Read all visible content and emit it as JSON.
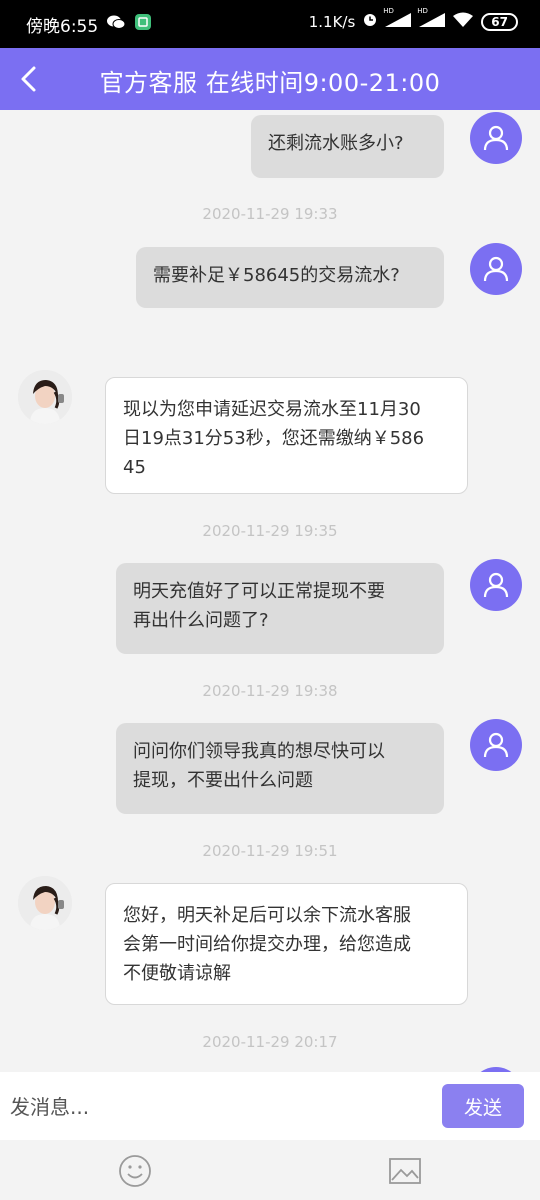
{
  "status_bar": {
    "time": "傍晚6:55",
    "speed": "1.1K/s",
    "battery": "67",
    "hd1": "HD",
    "hd2": "HD"
  },
  "header": {
    "title": "官方客服 在线时间9:00-21:00"
  },
  "messages": [
    {
      "from": "user",
      "text": "还剩流水账多小?"
    },
    {
      "time": "2020-11-29 19:33"
    },
    {
      "from": "user",
      "text": "需要补足￥58645的交易流水?"
    },
    {
      "from": "agent",
      "lines": [
        "现以为您申请延迟交易流水至11月30",
        "日19点31分53秒，您还需缴纳￥586",
        "45"
      ]
    },
    {
      "time": "2020-11-29 19:35"
    },
    {
      "from": "user",
      "lines": [
        "明天充值好了可以正常提现不要",
        "再出什么问题了?"
      ]
    },
    {
      "time": "2020-11-29 19:38"
    },
    {
      "from": "user",
      "lines": [
        "问问你们领导我真的想尽快可以",
        "提现，不要出什么问题"
      ]
    },
    {
      "time": "2020-11-29 19:51"
    },
    {
      "from": "agent",
      "lines": [
        "您好，明天补足后可以余下流水客服",
        "会第一时间给你提交办理，给您造成",
        "不便敬请谅解"
      ]
    },
    {
      "time": "2020-11-29 20:17"
    }
  ],
  "input": {
    "placeholder": "发消息...",
    "send_label": "发送"
  },
  "icons": {
    "back": "chevron-left-icon",
    "emoji": "smiley-icon",
    "image": "image-icon",
    "user_avatar": "user-icon"
  },
  "colors": {
    "brand": "#7b6ff2",
    "send_button": "#8b80f0",
    "outgoing_bubble": "#dcdcdc",
    "incoming_bubble": "#ffffff",
    "timestamp": "#c4c4c4"
  }
}
